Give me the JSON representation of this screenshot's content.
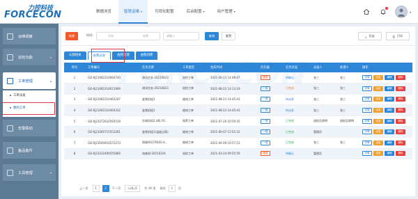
{
  "logo": {
    "cn": "力控科技",
    "en": "FORCECON"
  },
  "nav": {
    "items": [
      {
        "label": "数据浏览",
        "active": false,
        "caret": false
      },
      {
        "label": "智慧运维",
        "active": true,
        "caret": true
      },
      {
        "label": "可视化配置",
        "active": false,
        "caret": false
      },
      {
        "label": "后台配置",
        "active": false,
        "caret": true
      },
      {
        "label": "用户管理",
        "active": false,
        "caret": true
      }
    ]
  },
  "sidebar": {
    "items": [
      {
        "label": "运维调度",
        "active": false
      },
      {
        "label": "巡检功能",
        "active": false
      },
      {
        "label": "工单管理",
        "active": true
      },
      {
        "label": "告警联动",
        "active": false
      },
      {
        "label": "备品备件",
        "active": false
      },
      {
        "label": "工具管理",
        "active": false
      }
    ],
    "sub_items": [
      {
        "label": "工单派发",
        "selected": false
      },
      {
        "label": "我的工单",
        "selected": true
      }
    ]
  },
  "toolbar": {
    "new_label": "新建",
    "time_label": "时间:",
    "date_start_placeholder": "开始",
    "date_sep": "-",
    "date_end_placeholder": "结束",
    "search_placeholder": "请输入",
    "query_label": "查询",
    "reset_label": "重置",
    "export_label": "导出",
    "print_label": "打印"
  },
  "tabs": [
    {
      "label": "与我相关",
      "active": false
    },
    {
      "label": "由我派发",
      "active": true
    },
    {
      "label": "由我处理",
      "active": false
    },
    {
      "label": "由我创建",
      "active": false
    }
  ],
  "table": {
    "headers": [
      "序号",
      "工单编号",
      "任务名称",
      "工单类型",
      "生成时间",
      "优先级",
      "任务状态",
      "派送人",
      "处理人",
      "操作"
    ],
    "ops": {
      "detail": "详情",
      "assign": "派发",
      "edit": "编辑",
      "del": "删除"
    },
    "rows": [
      {
        "seq": "1",
        "code": "GD-XJ21082314664740",
        "name": "测试任务-20210823",
        "type": "巡检工单",
        "time": "2021-08-23 14:06:47",
        "priority": "紧急",
        "urgent": true,
        "status": "待确认",
        "status_color": "blue",
        "sender": "张三",
        "handler": "张三"
      },
      {
        "seq": "2",
        "code": "GD-XJ21082314611909",
        "name": "测试任务-20210823",
        "type": "巡检工单",
        "time": "2021-08-23 14:13:19",
        "priority": "一般",
        "urgent": false,
        "status": "已完成",
        "status_color": "orange",
        "sender": "张三",
        "handler": "张三"
      },
      {
        "seq": "3",
        "code": "GD-XJ21082314462247",
        "name": "变频机组1",
        "type": "维修工单",
        "time": "2021-08-23 14:45:43",
        "priority": "一般",
        "urgent": false,
        "status": "待派发",
        "status_color": "blue",
        "sender": "张三",
        "handler": "张三"
      },
      {
        "seq": "4",
        "code": "GD-XJ21082314464332",
        "name": "变频机组1",
        "type": "维修工单",
        "time": "2021-08-23 14:45:43",
        "priority": "一般",
        "urgent": false,
        "status": "待派发",
        "status_color": "blue",
        "sender": "张三",
        "handler": "张三"
      },
      {
        "seq": "5",
        "code": "GD-XJ21072610593519",
        "name": "空调风机2,4机 FV...",
        "type": "保养工单",
        "time": "2021-07-26 10:59:35",
        "priority": "一般",
        "urgent": false,
        "status": "已完成",
        "status_color": "green",
        "sender": "巡检员郑明",
        "handler": "巡检员郑明"
      },
      {
        "seq": "6",
        "code": "GD-XJ21060715553261",
        "name": "变频机组1(温度过高)",
        "type": "维修工单",
        "time": "2021-06-07 15:55:32",
        "priority": "一般",
        "urgent": false,
        "status": "已完成",
        "status_color": "green",
        "sender": "管理员",
        "handler": ""
      },
      {
        "seq": "7",
        "code": "GD-XJ21040910572273",
        "name": "网络HG37B(ES-4...",
        "type": "维修工单",
        "time": "2021-04-09 10:57:23",
        "priority": "一般",
        "urgent": false,
        "status": "已完成",
        "status_color": "green",
        "sender": "张三",
        "handler": "张三"
      },
      {
        "seq": "8",
        "code": "GD-XJ21032409555869",
        "name": "电梯测-20210324",
        "type": "巡检工单",
        "time": "2021-03-24 09:55:59",
        "priority": "紧急",
        "urgent": true,
        "status": "待确认",
        "status_color": "blue",
        "sender": "管理员",
        "handler": ""
      }
    ]
  },
  "pager": {
    "prev": "上一页",
    "pages": [
      "1",
      "2"
    ],
    "current": "2",
    "next": "下一页",
    "per_page": "20条/页",
    "total": "共 36 条",
    "goto_label": "前往",
    "goto_value": "1",
    "page_suffix": "页"
  },
  "colors": {
    "primary": "#2d86d8",
    "sidebar": "#5d7a94",
    "new_button": "#f0592a",
    "highlight_box": "#d9363e"
  }
}
